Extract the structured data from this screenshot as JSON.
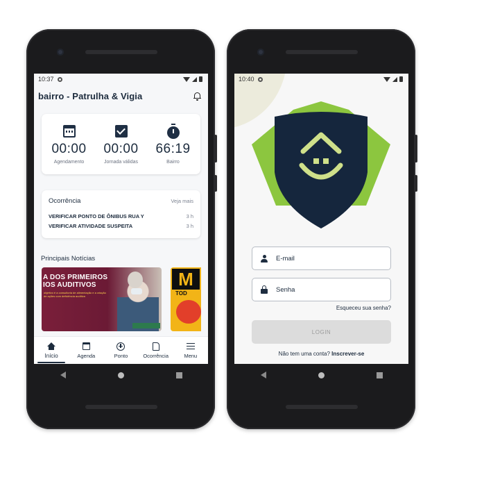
{
  "phone1": {
    "status": {
      "time": "10:37"
    },
    "header": {
      "title": "bairro - Patrulha & Vigia"
    },
    "stats": [
      {
        "icon": "calendar-icon",
        "value": "00:00",
        "label": "Agendamento"
      },
      {
        "icon": "checkbox-icon",
        "value": "00:00",
        "label": "Jornada válidas"
      },
      {
        "icon": "timer-icon",
        "value": "66:19",
        "label": "Bairro"
      }
    ],
    "occurrences": {
      "title": "Ocorrência",
      "see_more": "Veja mais",
      "items": [
        {
          "text": "VERIFICAR PONTO DE ÔNIBUS RUA Y",
          "time": "3 h"
        },
        {
          "text": "VERIFICAR ATIVIDADE SUSPEITA",
          "time": "3 h"
        }
      ]
    },
    "news": {
      "title": "Principais Notícias",
      "items": [
        {
          "headline_line1": "A DOS PRIMEIROS",
          "headline_line2": "IOS AUDITIVOS",
          "subtext": "objetivo é a consultoria de alimentação e a criação de ações com deficiência auditiva"
        },
        {
          "big": "M",
          "small": "TOD"
        }
      ]
    },
    "bottom_nav": [
      {
        "label": "Início",
        "icon": "home-icon",
        "active": true
      },
      {
        "label": "Agenda",
        "icon": "agenda-icon",
        "active": false
      },
      {
        "label": "Ponto",
        "icon": "plus-circle-icon",
        "active": false
      },
      {
        "label": "Ocorrência",
        "icon": "document-icon",
        "active": false
      },
      {
        "label": "Menu",
        "icon": "menu-icon",
        "active": false
      }
    ]
  },
  "phone2": {
    "status": {
      "time": "10:40"
    },
    "login": {
      "email_placeholder": "E-mail",
      "password_placeholder": "Senha",
      "forgot": "Esqueceu sua senha?",
      "button": "LOGIN",
      "no_account": "Não tem uma conta?",
      "signup": "Inscrever-se"
    }
  },
  "colors": {
    "primary": "#1c2b3d",
    "shield_navy": "#15263d",
    "shield_green": "#8cc63f",
    "house_green": "#cfe08a",
    "button_disabled": "#dcdcdc"
  }
}
